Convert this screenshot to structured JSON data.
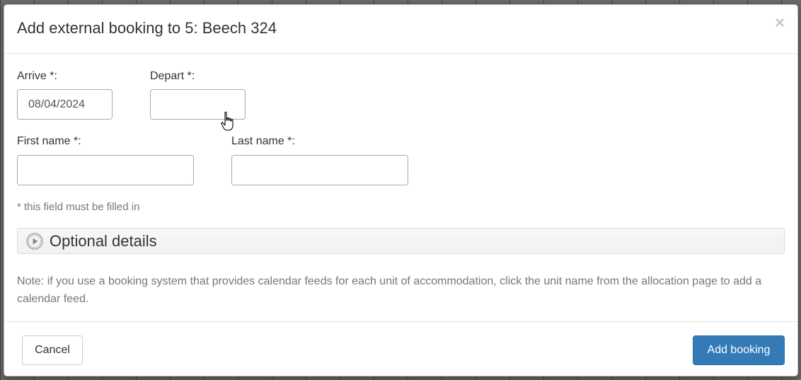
{
  "dialog": {
    "title": "Add external booking to 5: Beech 324",
    "close_label": "×"
  },
  "form": {
    "arrive": {
      "label": "Arrive *:",
      "value": "08/04/2024"
    },
    "depart": {
      "label": "Depart *:",
      "value": ""
    },
    "first_name": {
      "label": "First name *:",
      "value": ""
    },
    "last_name": {
      "label": "Last name *:",
      "value": ""
    },
    "required_note": "* this field must be filled in"
  },
  "optional_section": {
    "label": "Optional details",
    "icon": "play-circle-icon"
  },
  "note": "Note: if you use a booking system that provides calendar feeds for each unit of accommodation, click the unit name from the allocation page to add a calendar feed.",
  "footer": {
    "cancel_label": "Cancel",
    "add_label": "Add booking"
  },
  "colors": {
    "primary": "#337ab7",
    "text": "#333333",
    "muted": "#777777"
  }
}
